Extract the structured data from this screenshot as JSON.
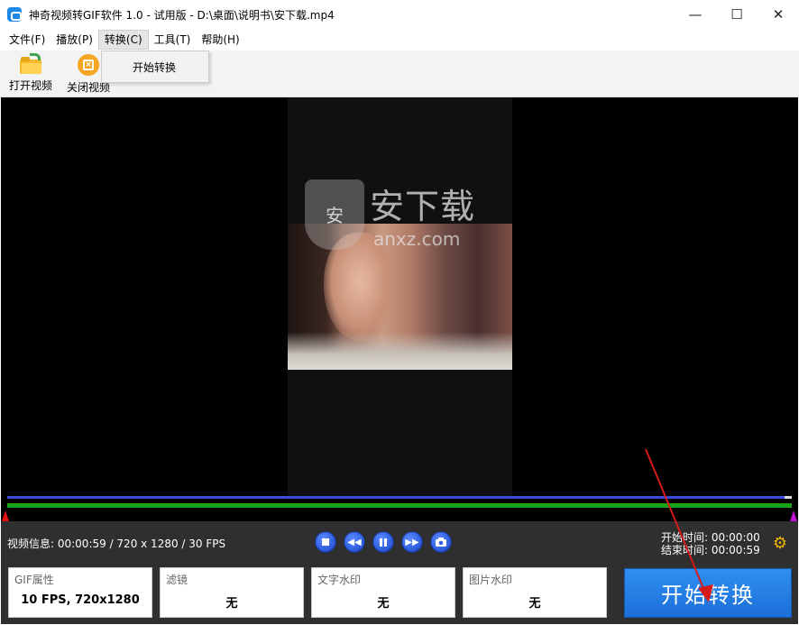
{
  "window": {
    "title": "神奇视频转GIF软件 1.0 - 试用版 - D:\\桌面\\说明书\\安下载.mp4",
    "minimize_glyph": "—",
    "maximize_glyph": "☐",
    "close_glyph": "✕"
  },
  "menu": {
    "items": [
      "文件(F)",
      "播放(P)",
      "转换(C)",
      "工具(T)",
      "帮助(H)"
    ],
    "active_index": 2,
    "dropdown": [
      "开始转换"
    ]
  },
  "toolbar": {
    "open_video": "打开视频",
    "close_video": "关闭视频"
  },
  "watermark": {
    "shield_text": "安",
    "brand": "安下载",
    "domain": "anxz.com"
  },
  "player": {
    "video_info": "视频信息: 00:00:59 / 720 x 1280 / 30 FPS",
    "start_time_label": "开始时间: 00:00:00",
    "end_time_label": "结束时间: 00:00:59",
    "controls": [
      "stop",
      "rewind",
      "pause",
      "fast-forward",
      "snapshot"
    ],
    "icons": [
      "stop-icon",
      "rewind-icon",
      "pause-icon",
      "fast-forward-icon",
      "camera-icon",
      "gear-icon"
    ]
  },
  "params": {
    "gif_props": {
      "title": "GIF属性",
      "value": "10 FPS, 720x1280"
    },
    "filter": {
      "title": "滤镜",
      "value": "无"
    },
    "text_watermark": {
      "title": "文字水印",
      "value": "无"
    },
    "image_watermark": {
      "title": "图片水印",
      "value": "无"
    }
  },
  "start_button": "开始转换",
  "colors": {
    "accent_blue": "#1c6fd8",
    "track_blue": "#3a4be0",
    "track_green": "#16a316",
    "start_marker": "#e01010",
    "end_marker": "#c010d0",
    "panel_bg": "#2f2f2f",
    "annotation_arrow": "#d61b1b"
  }
}
